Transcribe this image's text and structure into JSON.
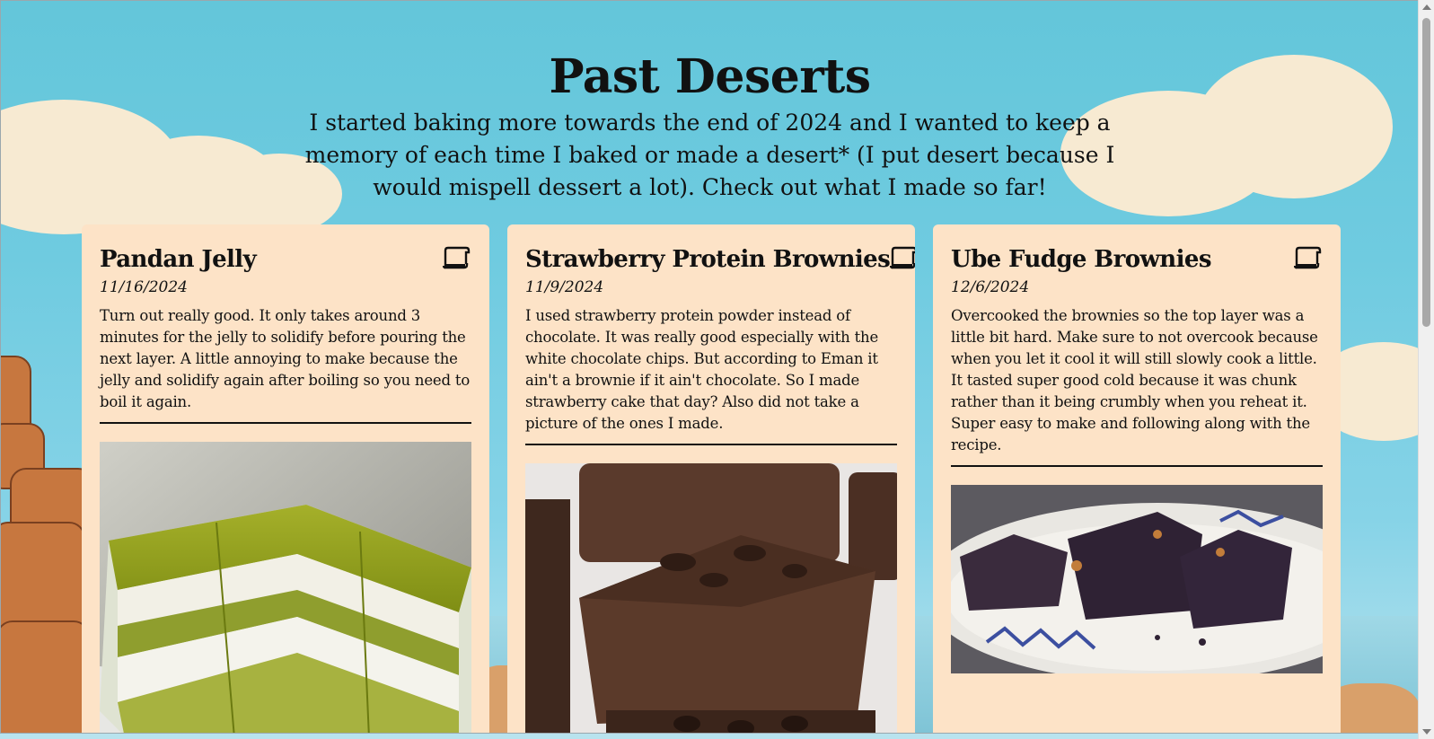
{
  "header": {
    "title": "Past Deserts",
    "intro": "I started baking more towards the end of 2024 and I wanted to keep a memory of each time I baked or made a desert* (I put desert because I would mispell dessert a lot). Check out what I made so far!"
  },
  "cards": [
    {
      "title": "Pandan Jelly",
      "date": "11/16/2024",
      "body": "Turn out really good. It only takes around 3 minutes for the jelly to solidify before pouring the next layer. A little annoying to make because the jelly and solidify again after boiling so you need to boil it again.",
      "icon": "recipe-scroll-icon"
    },
    {
      "title": "Strawberry Protein Brownies",
      "date": "11/9/2024",
      "body": "I used strawberry protein powder instead of chocolate. It was really good especially with the white chocolate chips. But according to Eman it ain't a brownie if it ain't chocolate. So I made strawberry cake that day? Also did not take a picture of the ones I made.",
      "icon": "recipe-scroll-icon"
    },
    {
      "title": "Ube Fudge Brownies",
      "date": "12/6/2024",
      "body": "Overcooked the brownies so the top layer was a little bit hard. Make sure to not overcook because when you let it cool it will still slowly cook a little. It tasted super good cold because it was chunk rather than it being crumbly when you reheat it. Super easy to make and following along with the recipe.",
      "icon": "recipe-scroll-icon"
    }
  ],
  "colors": {
    "card_background": "#fde3c7",
    "sky": "#63c6da",
    "text": "#111111"
  }
}
